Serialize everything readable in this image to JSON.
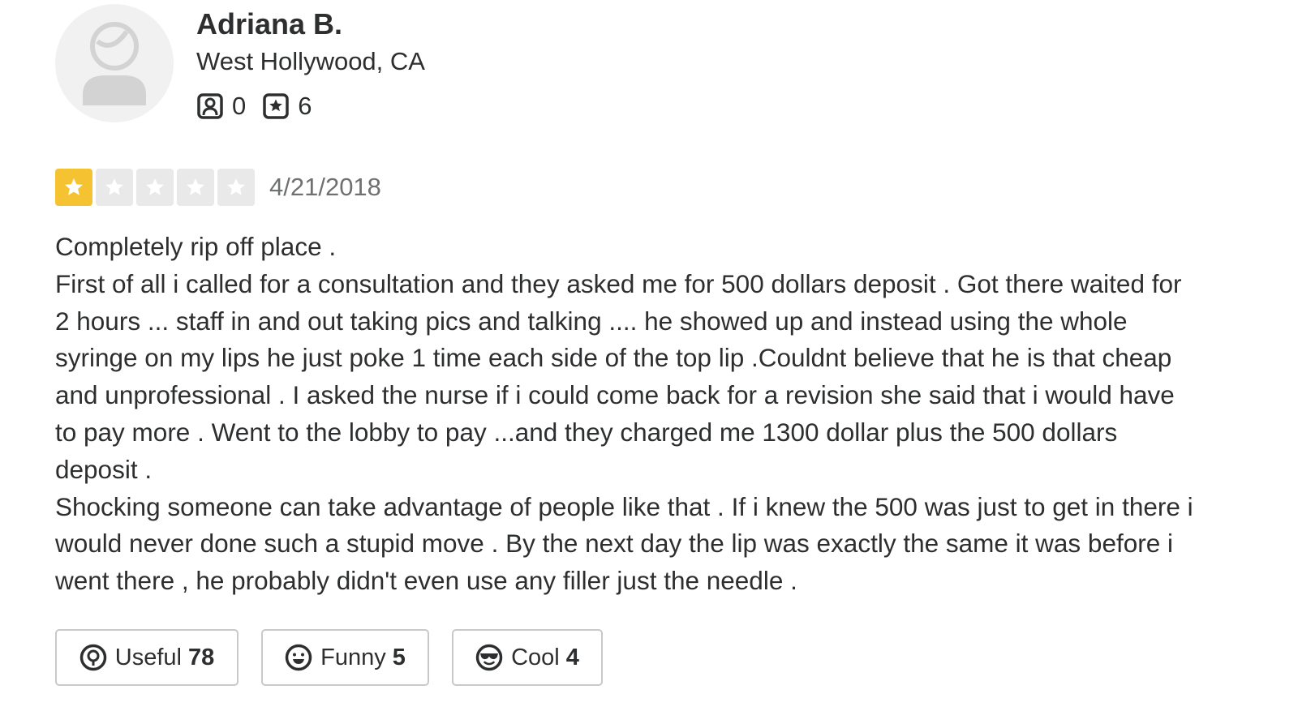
{
  "user": {
    "name": "Adriana B.",
    "location": "West Hollywood, CA",
    "avatar_icon": "default-user-avatar-icon",
    "friends_icon": "friends-icon",
    "friends_count": "0",
    "reviews_icon": "reviews-icon",
    "reviews_count": "6"
  },
  "review": {
    "rating": 1,
    "rating_max": 5,
    "star_color": "#f5c332",
    "date": "4/21/2018",
    "lines": [
      "Completely rip off place .",
      "First of all i called for a consultation and they asked me for 500 dollars deposit . Got there waited for",
      "2 hours ... staff in and out taking pics and talking .... he showed up and instead using the whole",
      "syringe on my lips he just poke 1 time each side of the top lip .Couldnt believe that he is that cheap",
      "and unprofessional . I asked the nurse if i could come back for a revision she said that i would have",
      "to pay more . Went to the lobby to pay ...and they charged me 1300 dollar plus the 500 dollars",
      "deposit .",
      "Shocking someone can take advantage of people like that . If i knew the 500  was just to get in there i",
      "would never done such a stupid move . By the next day the lip was exactly the same it was before i",
      "went there , he probably didn't even use any filler just the needle ."
    ]
  },
  "reactions": {
    "useful": {
      "label": "Useful",
      "count": "78",
      "icon": "lightbulb-icon"
    },
    "funny": {
      "label": "Funny",
      "count": "5",
      "icon": "smile-icon"
    },
    "cool": {
      "label": "Cool",
      "count": "4",
      "icon": "sunglasses-icon"
    }
  }
}
